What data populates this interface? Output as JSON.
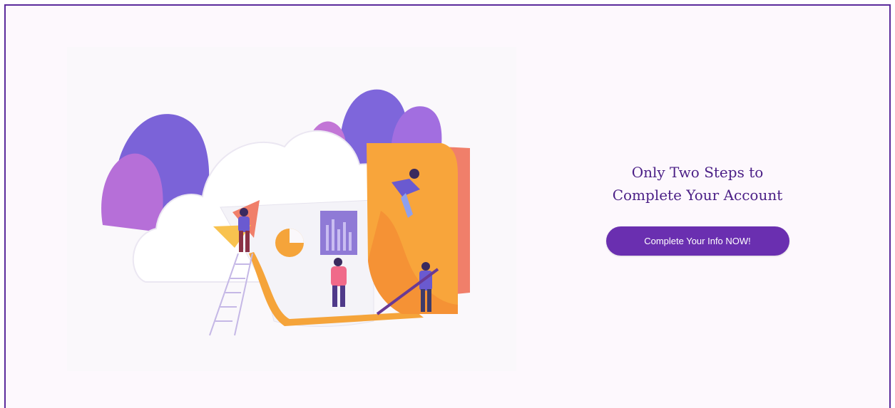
{
  "cta": {
    "headline_line1": "Only Two Steps to",
    "headline_line2": "Complete Your Account",
    "button_label": "Complete Your Info NOW!"
  },
  "colors": {
    "frame_border": "#5b2b9c",
    "headline": "#4b1f86",
    "button": "#6a2fb0",
    "button_text": "#ffffff"
  },
  "illustration": {
    "icon": "cloud-data-folder-illustration"
  }
}
